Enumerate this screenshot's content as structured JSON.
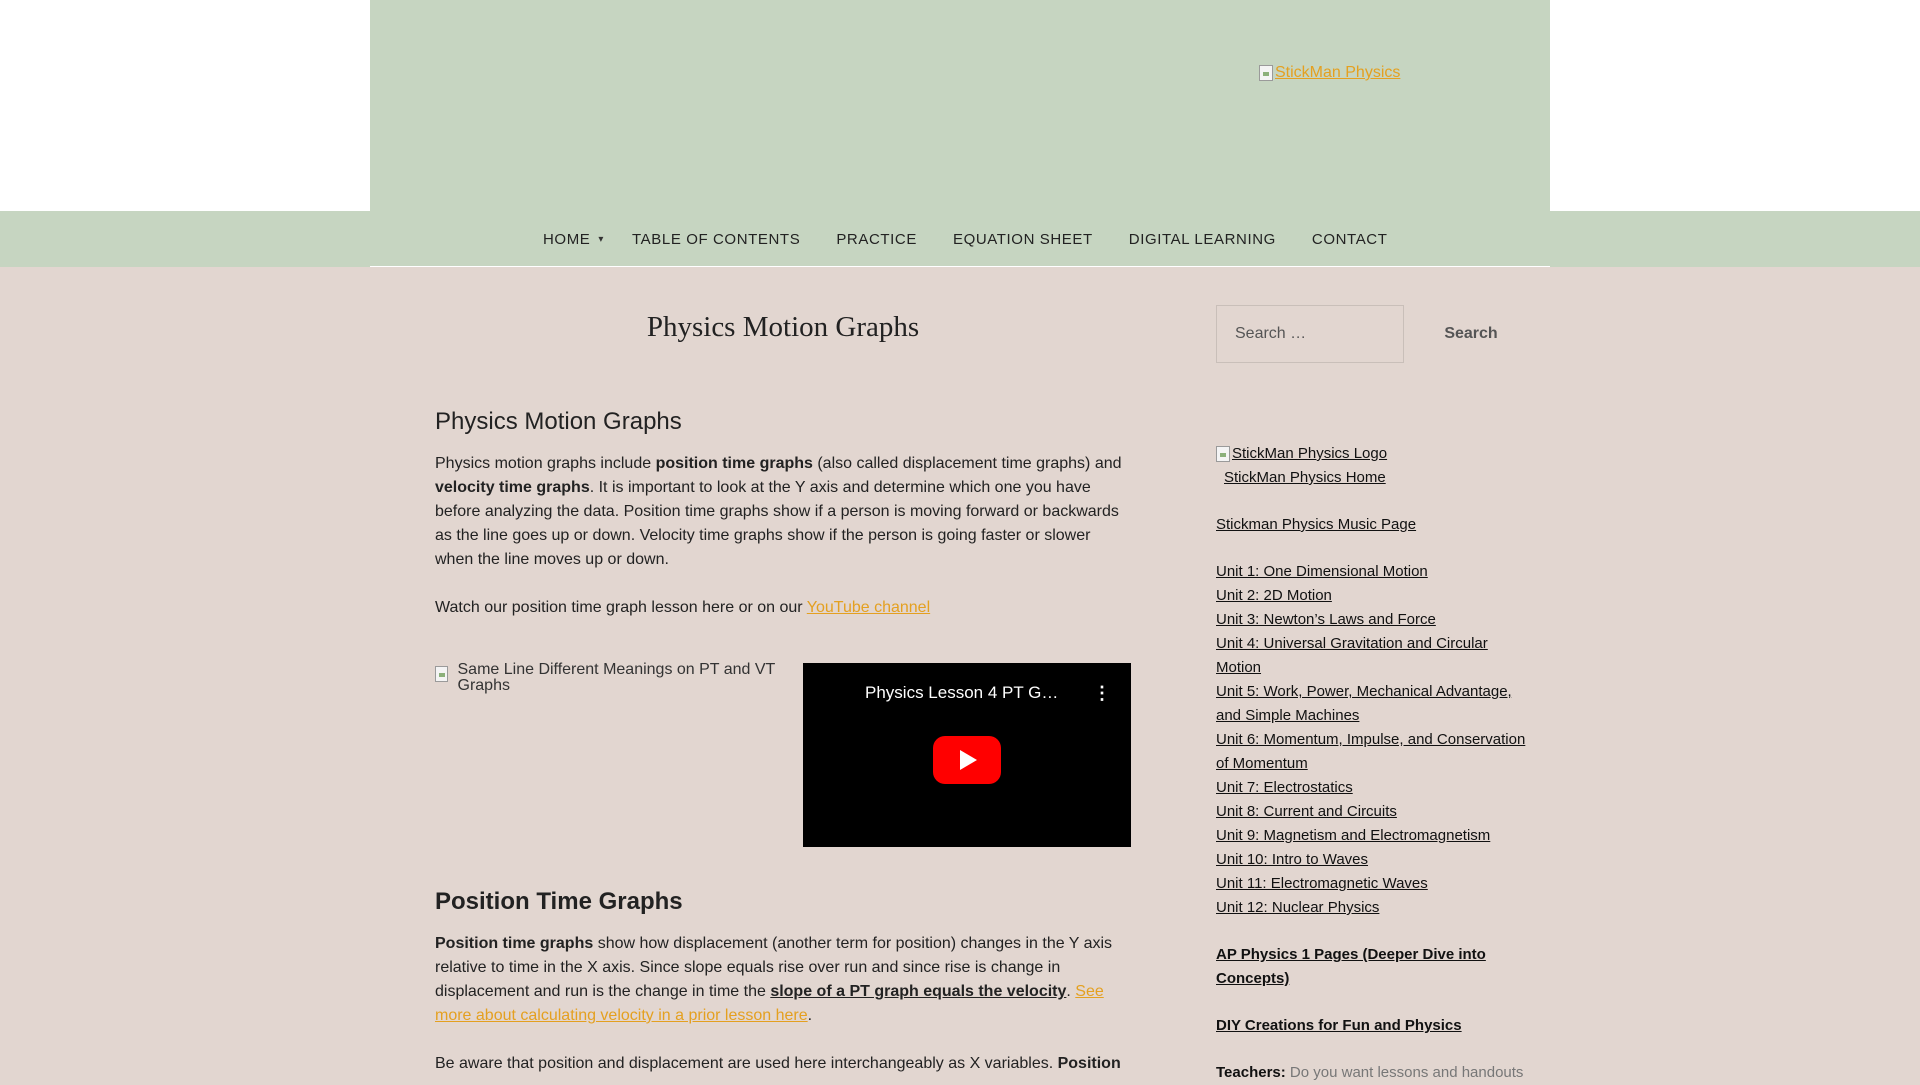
{
  "header": {
    "logo_alt": "StickMan Physics"
  },
  "nav": {
    "items": [
      {
        "label": "Home",
        "has_dropdown": true
      },
      {
        "label": "Table of Contents"
      },
      {
        "label": "Practice"
      },
      {
        "label": "Equation Sheet"
      },
      {
        "label": "Digital Learning"
      },
      {
        "label": "Contact"
      }
    ]
  },
  "main": {
    "page_title": "Physics Motion Graphs",
    "section_heading": "Physics Motion Graphs",
    "intro": {
      "t1": "Physics motion graphs include ",
      "b1": "position time graphs",
      "t2": " (also called displacement time graphs) and ",
      "b2": "velocity time graphs",
      "t3": ".  It is important to look at the Y axis and determine which one you have before analyzing the data.  Position time graphs show if a person is moving forward or backwards as the line goes up or down.  Velocity time graphs show if the person is going faster or slower when the line moves up or down."
    },
    "watch": {
      "text": "Watch our position time graph lesson here or on our ",
      "link": "YouTube channel"
    },
    "image_alt": "Same Line Different Meanings on PT and VT Graphs",
    "video": {
      "title": "Physics Lesson 4 PT G…",
      "menu": "⋮"
    },
    "pt_heading": "Position Time Graphs",
    "pt_para": {
      "b1": "Position time graphs",
      "t1": " show how displacement (another term for position) changes in the Y axis relative to time in the X axis.  Since slope equals rise over run and since rise is change in displacement and run is the change in time the ",
      "b2": "slope of a PT graph equals the velocity",
      "t2": ".  ",
      "link": "See more about calculating velocity in a prior lesson here",
      "t3": "."
    },
    "aware_para": {
      "t1": "Be aware that position and displacement are used here interchangeably as X variables.  ",
      "b1": "Position"
    }
  },
  "sidebar": {
    "search_placeholder": "Search …",
    "search_button": "Search",
    "logo_alt": "StickMan Physics Logo",
    "home_link": "StickMan Physics Home",
    "music_link": "Stickman Physics Music Page",
    "units": [
      "Unit 1: One Dimensional Motion",
      "Unit 2: 2D Motion",
      "Unit 3: Newton’s Laws and Force",
      "Unit 4: Universal Gravitation and Circular Motion",
      "Unit 5: Work, Power, Mechanical Advantage, and Simple Machines",
      "Unit 6: Momentum, Impulse, and Conservation of Momentum",
      "Unit 7: Electrostatics",
      "Unit 8: Current and Circuits",
      "Unit 9: Magnetism and Electromagnetism",
      "Unit 10: Intro to Waves",
      "Unit 11: Electromagnetic Waves",
      "Unit 12: Nuclear Physics"
    ],
    "ap_link": "AP Physics 1 Pages (Deeper Dive into Concepts)",
    "diy_link": "DIY Creations for Fun and Physics",
    "teachers_label": "Teachers:",
    "teachers_text": " Do you want lessons and handouts"
  },
  "colors": {
    "header_bg": "#c6d5c1",
    "page_bg": "#e2d6d0",
    "accent_link": "#e4a020"
  }
}
